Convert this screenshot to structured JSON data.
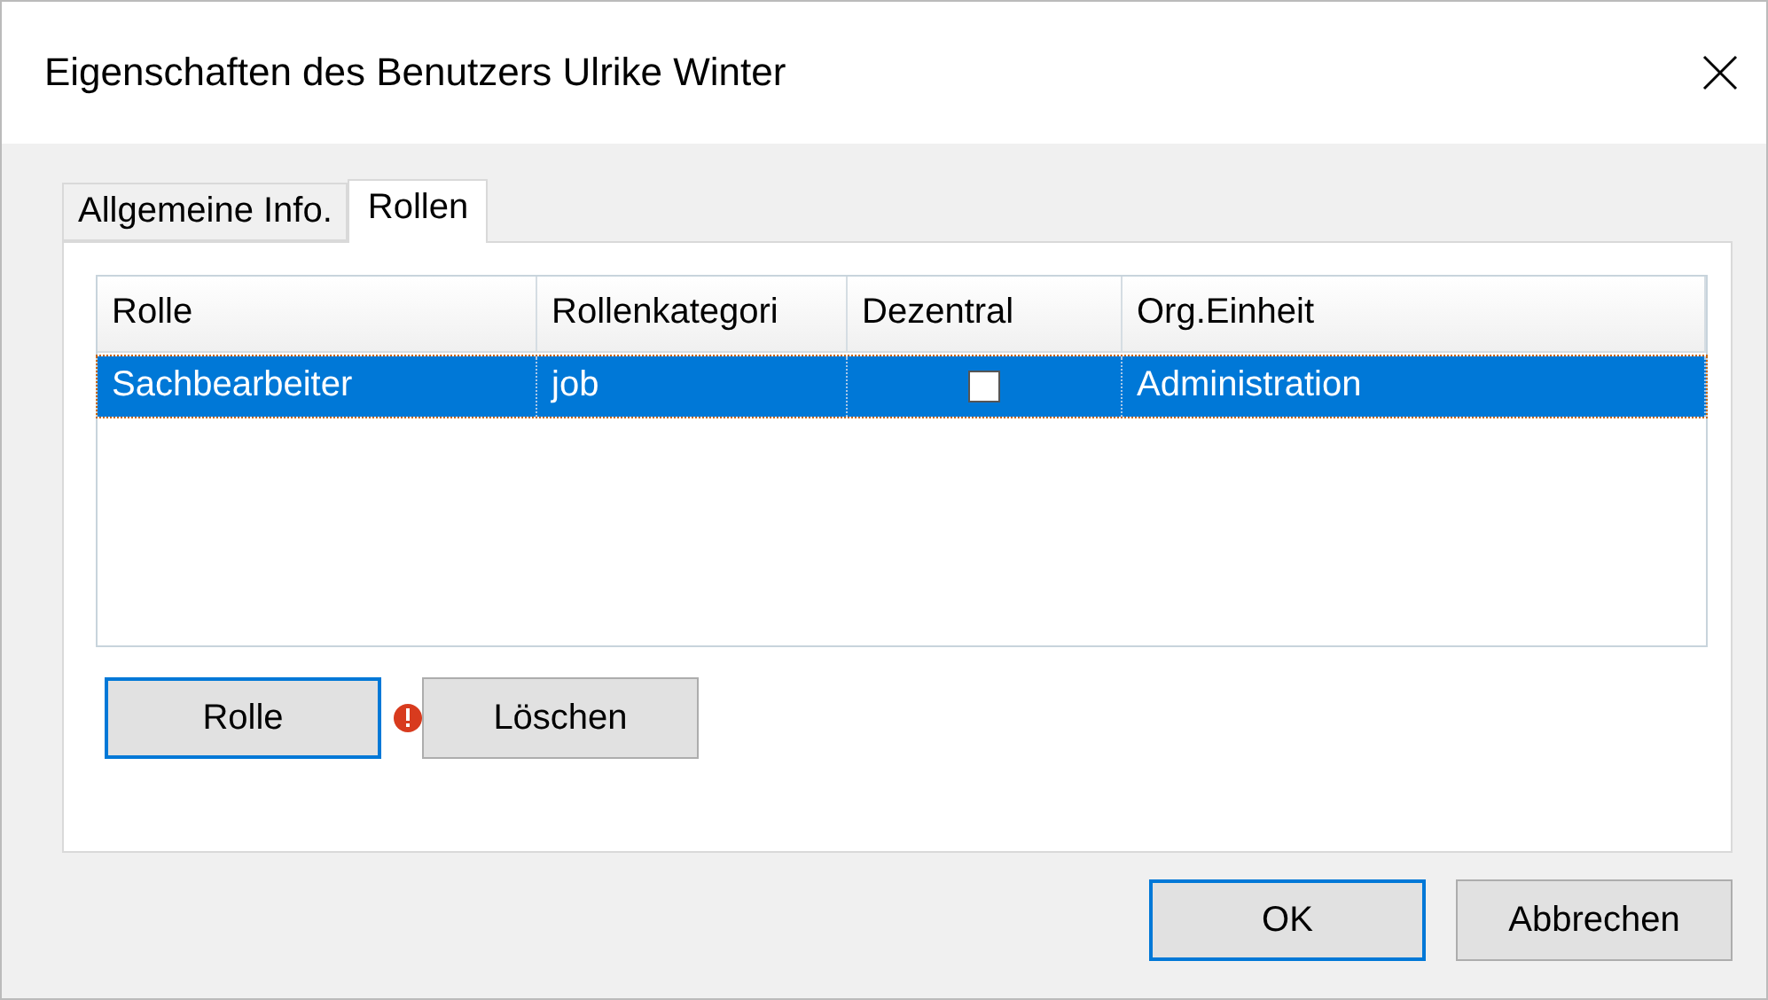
{
  "window": {
    "title": "Eigenschaften des Benutzers Ulrike Winter"
  },
  "tabs": [
    {
      "label": "Allgemeine Info.",
      "selected": false
    },
    {
      "label": "Rollen",
      "selected": true
    }
  ],
  "table": {
    "columns": [
      "Rolle",
      "Rollenkategori",
      "Dezentral",
      "Org.Einheit"
    ],
    "rows": [
      {
        "role": "Sachbearbeiter",
        "category": "job",
        "decentral": false,
        "unit": "Administration",
        "selected": true
      }
    ]
  },
  "actions": [
    {
      "label": "Rolle",
      "focused": true,
      "warning": false
    },
    {
      "label": "Löschen",
      "focused": false,
      "warning": true
    }
  ],
  "buttons": [
    {
      "label": "OK",
      "focused": true
    },
    {
      "label": "Abbrechen",
      "focused": false
    }
  ]
}
